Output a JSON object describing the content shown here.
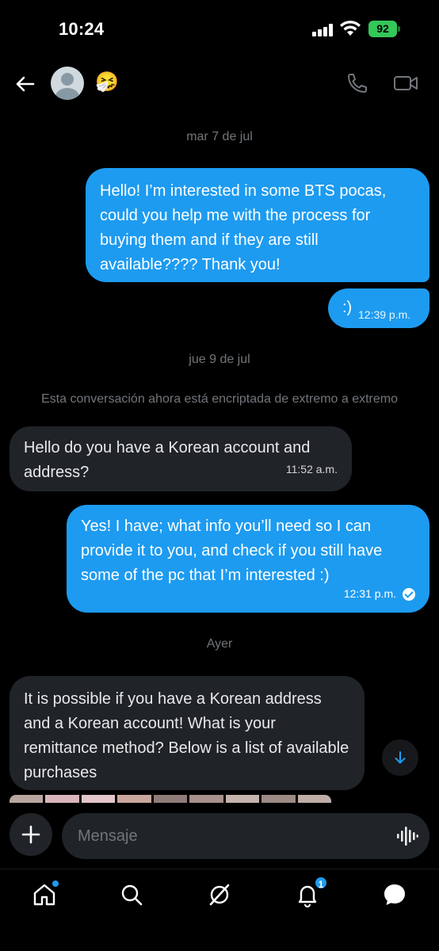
{
  "status_bar": {
    "time": "10:24",
    "battery": "92"
  },
  "header": {
    "emoji": "🤧",
    "icons": {
      "back": "arrow-left-icon",
      "phone": "phone-icon",
      "video": "video-camera-icon"
    }
  },
  "conversation": {
    "date_1": "mar 7 de jul",
    "msg_1": "Hello! I’m interested in some BTS pocas, could you help me with the process for buying them and if they are still available???? Thank you!",
    "msg_2_text": ":)",
    "msg_2_time": "12:39 p.m.",
    "date_2": "jue 9 de jul",
    "encryption_note": "Esta conversación ahora está encriptada de extremo a extremo",
    "msg_3": "Hello do you have a Korean account and address?",
    "msg_3_time": "11:52 a.m.",
    "msg_4": "Yes! I have; what info you’ll need so I can provide it to you, and check if you still have some of the pc that I’m interested :)",
    "msg_4_time": "12:31 p.m.",
    "date_3": "Ayer",
    "msg_5": "It is possible if you have a Korean address and a Korean account! What is your remittance method? Below is a list of available purchases"
  },
  "composer": {
    "placeholder": "Mensaje"
  },
  "bottom_nav": {
    "notification_count": "1",
    "items": [
      "home-icon",
      "search-icon",
      "grok-icon",
      "bell-icon",
      "messages-icon"
    ]
  },
  "colors": {
    "accent": "#1d9bf0",
    "incoming_bubble": "#202327",
    "background": "#000000",
    "muted_text": "#71767b",
    "battery": "#34c759"
  }
}
